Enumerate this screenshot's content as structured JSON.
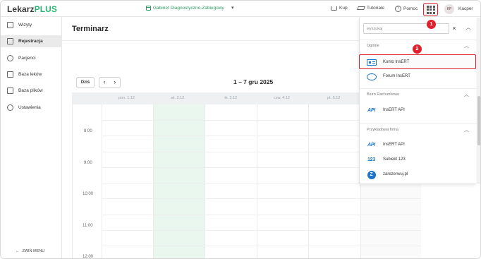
{
  "app": {
    "logo_part1": "Lekarz",
    "logo_part2": "PLUS",
    "clinic": "Gabinet Diagnostyczno-Zabiegowy",
    "kup": "Kup",
    "tutoriale": "Tutoriale",
    "pomoc": "Pomoc",
    "user_initials": "KP",
    "user_name": "Kacper"
  },
  "badges": {
    "one": "1",
    "two": "2"
  },
  "sidebar": {
    "items": [
      {
        "label": "Wizyty",
        "icon": "clipboard-icon"
      },
      {
        "label": "Rejestracja",
        "icon": "calendar-icon"
      },
      {
        "label": "Pacjenci",
        "icon": "people-icon"
      },
      {
        "label": "Baza leków",
        "icon": "medicine-icon"
      },
      {
        "label": "Baza plików",
        "icon": "files-icon"
      },
      {
        "label": "Ustawienia",
        "icon": "gear-icon"
      }
    ],
    "collapse_label": "ZWIŃ MENU"
  },
  "main": {
    "title": "Terminarz",
    "today_btn": "Dziś",
    "range": "1 – 7 gru 2025",
    "days": [
      "pon. 1.12",
      "wt. 2.12",
      "śr. 3.12",
      "czw. 4.12",
      "pt. 5.12"
    ],
    "times": [
      "8:00",
      "9:00",
      "10:00",
      "11:00",
      "12:00"
    ]
  },
  "panel": {
    "search_placeholder": "wyszukaj",
    "sections": [
      {
        "title": "Ogólne",
        "items": [
          "Konto InsERT",
          "Forum InsERT"
        ]
      },
      {
        "title": "Biuro Rachunkowe",
        "items": [
          "InsERT API"
        ]
      },
      {
        "title": "Przykładowa firma",
        "items": [
          "InsERT API",
          "Subiekt 123",
          "zarezerwuj.pl"
        ]
      }
    ]
  },
  "colors": {
    "accent": "#2bb673",
    "highlight": "#e0202c",
    "brand_blue": "#1b74c9",
    "today_column": "#eaf7ef"
  }
}
